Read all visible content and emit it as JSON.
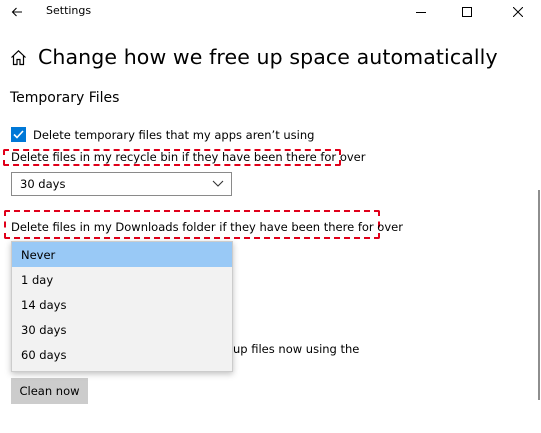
{
  "window": {
    "title": "Settings",
    "back_icon": "arrow-left-icon",
    "minimize_icon": "minimize-icon",
    "maximize_icon": "maximize-icon",
    "close_icon": "close-icon"
  },
  "page": {
    "home_icon": "home-icon",
    "title": "Change how we free up space automatically"
  },
  "temporary_files": {
    "heading": "Temporary Files",
    "delete_temp_checkbox": {
      "label": "Delete temporary files that my apps aren’t using",
      "checked": true
    },
    "recycle_bin": {
      "label": "Delete files in my recycle bin if they have been there for over",
      "selected": "30 days"
    },
    "downloads": {
      "label": "Delete files in my Downloads folder if they have been there for over",
      "options": [
        "Never",
        "1 day",
        "14 days",
        "30 days",
        "60 days"
      ],
      "highlighted_option": "Never"
    },
    "partially_hidden_text": "up files now using the",
    "clean_now_button": "Clean now"
  },
  "colors": {
    "accent": "#0078d7",
    "annotation_dash": "#e0001a",
    "dropdown_highlight": "#99c9f6",
    "button_bg": "#cccccc"
  }
}
